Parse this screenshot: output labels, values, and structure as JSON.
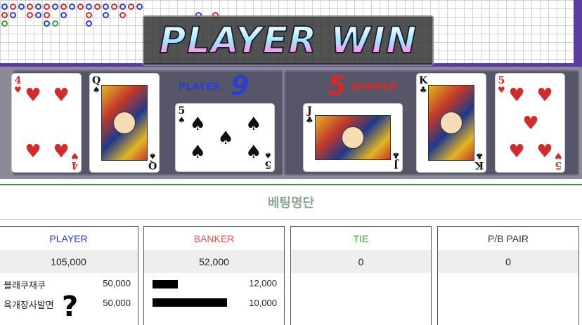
{
  "banner": {
    "text": "PLAYER WIN"
  },
  "scores": {
    "player_label": "PLAYER",
    "player_score": "9",
    "banker_label": "BANKER",
    "banker_score": "5"
  },
  "cards": {
    "player": [
      {
        "rank": "4",
        "suit": "♥",
        "color": "red"
      },
      {
        "rank": "Q",
        "suit": "♠",
        "color": "black"
      },
      {
        "rank": "5",
        "suit": "♠",
        "color": "black"
      }
    ],
    "banker": [
      {
        "rank": "J",
        "suit": "♣",
        "color": "black"
      },
      {
        "rank": "K",
        "suit": "♣",
        "color": "black"
      },
      {
        "rank": "5",
        "suit": "♥",
        "color": "red"
      }
    ]
  },
  "bet_list": {
    "title": "베팅명단",
    "columns": [
      {
        "header": "PLAYER",
        "header_color": "#2a3fd0",
        "total": "105,000",
        "rows": [
          {
            "name": "블래쿠재쿠",
            "amount": "50,000"
          },
          {
            "name": "육개장사발면",
            "amount": "50,000"
          }
        ]
      },
      {
        "header": "BANKER",
        "header_color": "#e05252",
        "total": "52,000",
        "rows": [
          {
            "name": "",
            "amount": "12,000"
          },
          {
            "name": "",
            "amount": "10,000"
          }
        ]
      },
      {
        "header": "TIE",
        "header_color": "#3aa53a",
        "total": "0",
        "rows": []
      },
      {
        "header": "P/B PAIR",
        "header_color": "#333333",
        "total": "0",
        "rows": []
      }
    ]
  },
  "annotation": {
    "mark": "?"
  },
  "colors": {
    "accent_purple": "#5a3e9e",
    "divider_green": "#3a8f4e"
  }
}
